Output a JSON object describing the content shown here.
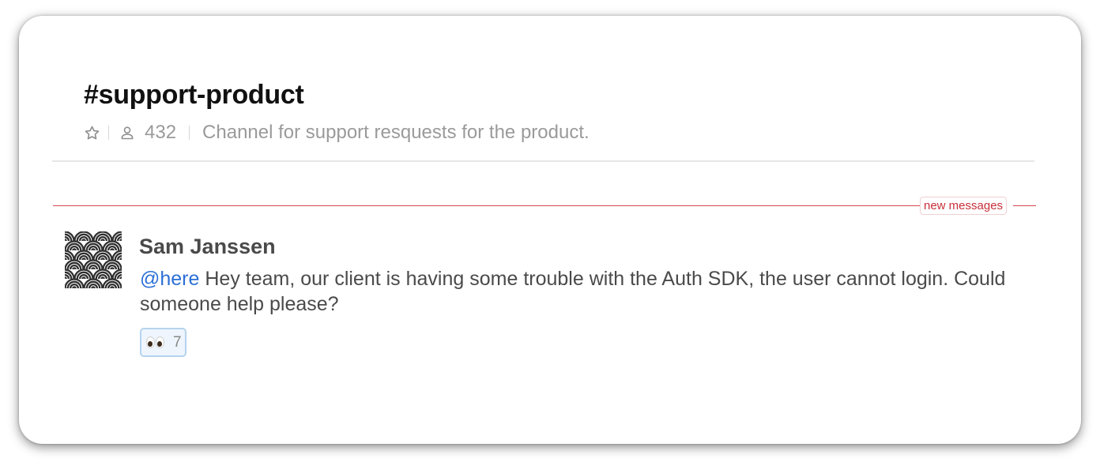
{
  "channel": {
    "title": "#support-product",
    "member_count": "432",
    "description": "Channel for support resquests for the product."
  },
  "divider": {
    "new_messages_label": "new messages"
  },
  "message": {
    "author": "Sam Janssen",
    "mention": "@here",
    "text": " Hey team, our client is having some trouble with the Auth SDK, the user cannot login. Could someone help please?",
    "reactions": [
      {
        "emoji_icon": "eyes-emoji",
        "count": "7"
      }
    ]
  },
  "colors": {
    "mention": "#2c6fd6",
    "new_messages": "#d4474f",
    "reaction_border": "#b5d3ee"
  }
}
